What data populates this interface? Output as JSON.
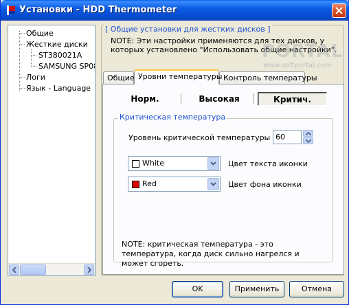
{
  "window": {
    "title": "Установки - HDD Thermometer",
    "close_icon": "close-icon"
  },
  "tree": {
    "items": [
      {
        "label": "Общие"
      },
      {
        "label": "Жесткие диски"
      },
      {
        "label": "ST380021A"
      },
      {
        "label": "SAMSUNG SP08"
      },
      {
        "label": "Логи"
      },
      {
        "label": "Язык - Language"
      }
    ]
  },
  "group": {
    "title": "[ Общие установки для жестких дисков ]",
    "note": "NOTE: Эти настройки применяются для тех дисков, у которых установлено \"Использовать общие настройки\"."
  },
  "watermark": {
    "big": "PORTAL",
    "small": "www.softportal.com"
  },
  "tabs": [
    {
      "label": "Общие"
    },
    {
      "label": "Уровни температуры"
    },
    {
      "label": "Контроль температуры"
    }
  ],
  "levels": {
    "normal": "Норм.",
    "high": "Высокая",
    "critical": "Критич."
  },
  "critical": {
    "group_title": "Критическая температура",
    "level_label": "Уровень критической температуры (°C)",
    "level_value": "60",
    "text_color": {
      "value": "White",
      "swatch": "#ffffff",
      "label": "Цвет текста иконки"
    },
    "bg_color": {
      "value": "Red",
      "swatch": "#e00000",
      "label": "Цвет фона иконки"
    },
    "note": "NOTE: критическая температура - это температура, когда диск сильно нагрелся и может сгореть."
  },
  "buttons": {
    "ok": "OK",
    "apply": "Применить",
    "cancel": "Отмена"
  }
}
